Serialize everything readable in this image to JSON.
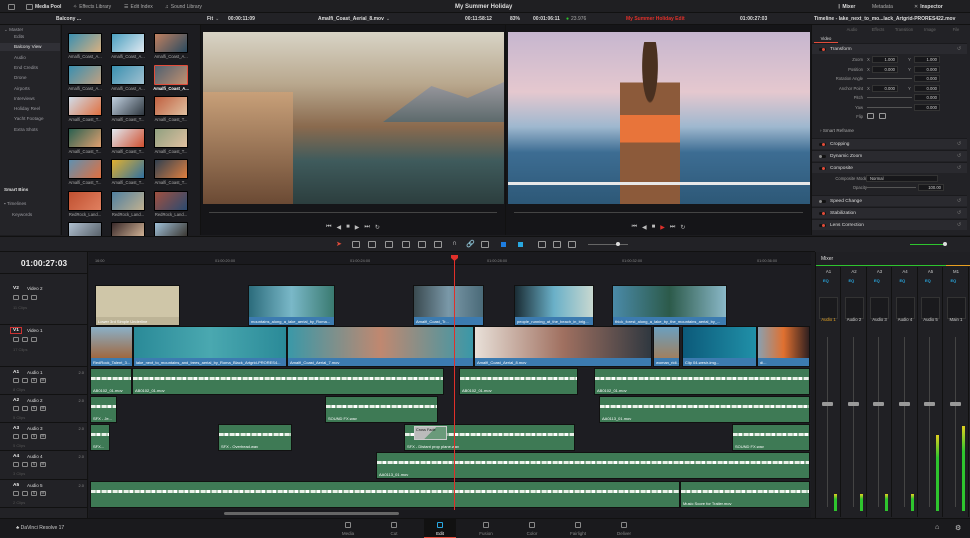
{
  "app": {
    "name": "DaVinci Resolve 17",
    "project": "My Summer Holiday"
  },
  "top_left_tabs": [
    {
      "label": "Media Pool",
      "active": true
    },
    {
      "label": "Effects Library"
    },
    {
      "label": "Edit Index"
    },
    {
      "label": "Sound Library"
    }
  ],
  "top_right_tabs": [
    {
      "label": "Mixer",
      "active": true
    },
    {
      "label": "Metadata"
    },
    {
      "label": "Inspector",
      "active": true
    }
  ],
  "source_viewer": {
    "bin": "Balcony ...",
    "zoom": "Fit",
    "timecode": "00:00:11:09",
    "clip": "Amalfi_Coast_Aerial_8.mov",
    "end_tc": "00:11:58:12"
  },
  "timeline_viewer": {
    "zoom": "83%",
    "duration": "00:01:06:11",
    "fps": "23.976",
    "timeline": "My Summer Holiday Edit",
    "timecode": "01:00:27:03"
  },
  "inspector_title": "Timeline - lake_next_to_mo...lack_Artgrid-PRORES422.mov",
  "sidebar": {
    "master": "Master",
    "items": [
      "Edits",
      "Balcony View",
      "Audio",
      "End Credits",
      "Drone",
      "Airports",
      "Interviews",
      "Holiday Reel",
      "Yacht Footage",
      "Extra Shots"
    ],
    "selected": "Balcony View",
    "smart_bins": "Smart Bins",
    "smart_items": [
      "Timelines",
      "Keywords"
    ]
  },
  "bin_clips": [
    "Amalfi_Coast_A...",
    "Amalfi_Coast_A...",
    "Amalfi_Coast_A...",
    "Amalfi_Coast_A...",
    "Amalfi_Coast_A...",
    "Amalfi_Coast_A...",
    "Amalfi_Coast_T...",
    "Amalfi_Coast_T...",
    "Amalfi_Coast_T...",
    "Amalfi_Coast_T...",
    "Amalfi_Coast_T...",
    "Amalfi_Coast_T...",
    "Amalfi_Coast_T...",
    "Amalfi_Coast_T...",
    "Amalfi_Coast_T...",
    "RedRock_Land...",
    "RedRock_Land...",
    "RedRock_Land...",
    "",
    "",
    ""
  ],
  "bin_selected_index": 5,
  "inspector": {
    "tabs": [
      "Video",
      "Audio",
      "Effects",
      "Transition",
      "Image",
      "File"
    ],
    "active_tab": "Video",
    "transform": "Transform",
    "params": [
      {
        "label": "Zoom",
        "x": "1.000",
        "y": "1.000"
      },
      {
        "label": "Position",
        "x": "0.000",
        "y": "0.000"
      },
      {
        "label": "Rotation Angle",
        "value": "0.000"
      },
      {
        "label": "Anchor Point",
        "x": "0.000",
        "y": "0.000"
      },
      {
        "label": "Pitch",
        "value": "0.000"
      },
      {
        "label": "Yaw",
        "value": "0.000"
      },
      {
        "label": "Flip"
      }
    ],
    "smart_reframe": "Smart Reframe",
    "sections": [
      "Cropping",
      "Dynamic Zoom",
      "Composite"
    ],
    "composite_mode_label": "Composite Mode",
    "composite_mode": "Normal",
    "opacity_label": "Opacity",
    "opacity": "100.00",
    "sections2": [
      "Speed Change",
      "Stabilization",
      "Lens Correction"
    ]
  },
  "timeline": {
    "timecode": "01:00:27:03",
    "ruler": [
      "16:00",
      "01:00:20:00",
      "01:00:24:00",
      "01:00:28:00",
      "01:00:32:00",
      "01:00:36:00"
    ],
    "tracks": [
      {
        "id": "V2",
        "name": "Video 2",
        "clips": "11 Clips"
      },
      {
        "id": "V1",
        "name": "Video 1",
        "clips": "17 Clips"
      },
      {
        "id": "A1",
        "name": "Audio 1",
        "ch": "2.0",
        "clips": "8 Clips"
      },
      {
        "id": "A2",
        "name": "Audio 2",
        "ch": "2.0",
        "clips": "5 Clips"
      },
      {
        "id": "A3",
        "name": "Audio 3",
        "ch": "2.0",
        "clips": "5 Clips"
      },
      {
        "id": "A4",
        "name": "Audio 4",
        "ch": "2.0",
        "clips": "3 Clips"
      },
      {
        "id": "A5",
        "name": "Audio 5",
        "ch": "2.0",
        "clips": "2 Clips"
      }
    ],
    "v2": [
      "Lower 3rd Simple Underline",
      "mountains_along_a_lake_aerial_by_Roma...",
      "Amalfi_Coast_Tr...",
      "people_running_at_the_beach_in_brig...",
      "thick_forest_along_a_lake_by_the_mountains_aerial_by_..."
    ],
    "v1": [
      "RedRock_Talent_3...",
      "lake_next_to_mountains_and_trees_aerial_by_Roma_Black_Artgrid-PRORES4...",
      "Amalfi_Coast_Aerial_7.mov",
      "Amalfi_Coast_Aerial_8.mov",
      "woman_ridi...",
      "Clip 04-wesir-img...",
      "di..."
    ],
    "a1": [
      "AB0102_01.mov",
      "AB0102_01.mov",
      "AB0102_01.mov",
      "AB0102_01.mov"
    ],
    "a2": [
      "SFX - Je...",
      "SOUND FX.wav",
      "AA0113_01.mov"
    ],
    "a3": [
      "SFX...",
      "SFX - Overhead.wav",
      "SFX - Distant prop plane.wav",
      "SOUND FX.wav"
    ],
    "a4": [
      "AA0113_01.mov"
    ],
    "a5": [
      "",
      "Music Score for Trailer.mov"
    ],
    "transition_label": "Cross Fade"
  },
  "mixer": {
    "title": "Mixer",
    "channels": [
      {
        "bus": "A1",
        "label": "Audio 1",
        "fader": 0.62,
        "meter": 0.1
      },
      {
        "bus": "A2",
        "label": "Audio 2",
        "fader": 0.62,
        "meter": 0.1
      },
      {
        "bus": "A3",
        "label": "Audio 3",
        "fader": 0.62,
        "meter": 0.1
      },
      {
        "bus": "A4",
        "label": "Audio 4",
        "fader": 0.62,
        "meter": 0.1
      },
      {
        "bus": "A5",
        "label": "Audio 5",
        "fader": 0.62,
        "meter": 0.45
      },
      {
        "bus": "M1",
        "label": "Main 1",
        "fader": 0.62,
        "meter": 0.5
      }
    ],
    "eq": "EQ"
  },
  "pages": [
    "Media",
    "Cut",
    "Edit",
    "Fusion",
    "Color",
    "Fairlight",
    "Deliver"
  ],
  "active_page": "Edit",
  "colors": {
    "accent": "#e24c3a",
    "playhead": "#e0302a",
    "video_clip": "#3c7bb0",
    "audio_clip": "#3e7a55",
    "timeline_name": "#e0302a"
  }
}
